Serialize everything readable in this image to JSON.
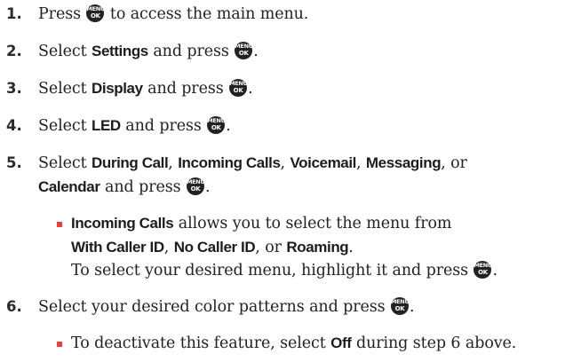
{
  "key_icon": {
    "top": "MENU",
    "bottom": "OK"
  },
  "steps": [
    {
      "number": "1.",
      "lines": [
        {
          "before": "Press ",
          "after": " to access the main menu."
        }
      ]
    },
    {
      "number": "2.",
      "lines": [
        {
          "before": "Select ",
          "bold": "Settings",
          "after": " and press "
        }
      ]
    },
    {
      "number": "3.",
      "lines": [
        {
          "before": "Select ",
          "bold": "Display",
          "after": " and press "
        }
      ]
    },
    {
      "number": "4.",
      "lines": [
        {
          "before": "Select ",
          "bold": "LED",
          "after": " and press "
        }
      ]
    },
    {
      "number": "5.",
      "lines": [
        {
          "before": "Select ",
          "b1": "During Call",
          "s1": ", ",
          "b2": "Incoming Calls",
          "s2": ", ",
          "b3": "Voicemail",
          "s3": ", ",
          "b4": "Messaging",
          "s4": ", or"
        },
        {
          "b1": "Calendar",
          "after": " and press "
        }
      ],
      "bullet": {
        "lines": [
          {
            "b1": "Incoming Calls",
            "after": " allows you to select the menu from"
          },
          {
            "b1": "With Caller ID",
            "s1": ", ",
            "b2": "No Caller ID",
            "s2": ", or ",
            "b3": "Roaming",
            "s3": "."
          },
          {
            "text": "To select your desired menu, highlight it and press "
          }
        ]
      }
    },
    {
      "number": "6.",
      "lines": [
        {
          "text": "Select your desired color patterns and press "
        }
      ],
      "bullet": {
        "lines": [
          {
            "before": "To deactivate this feature, select ",
            "bold": "Off",
            "after": " during step 6 above."
          }
        ]
      }
    }
  ]
}
